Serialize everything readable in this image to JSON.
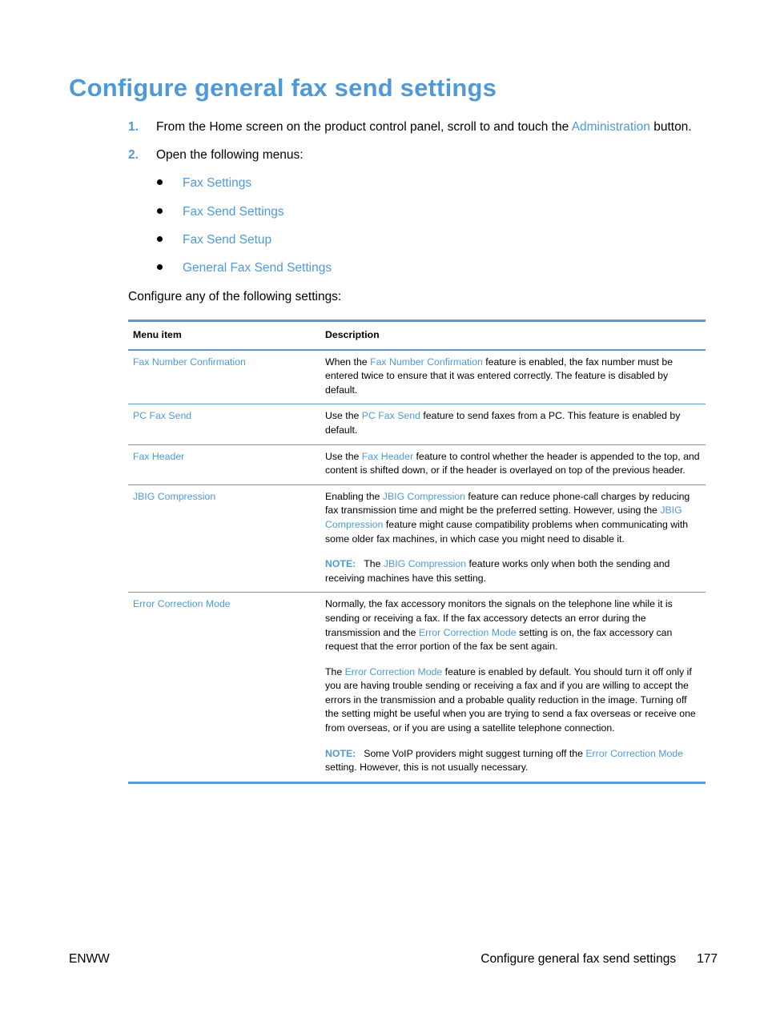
{
  "page": {
    "title": "Configure general fax send settings",
    "steps": [
      {
        "number": "1.",
        "before": "From the Home screen on the product control panel, scroll to and touch the ",
        "link": "Administration",
        "after": " button."
      },
      {
        "number": "2.",
        "text": "Open the following menus:"
      }
    ],
    "menus": [
      "Fax Settings",
      "Fax Send Settings",
      "Fax Send Setup",
      "General Fax Send Settings"
    ],
    "intro": "Configure any of the following settings:"
  },
  "table": {
    "headers": {
      "menu_item": "Menu item",
      "description": "Description"
    },
    "rows": [
      {
        "item": "Fax Number Confirmation",
        "p1": {
          "a": "When the ",
          "link": "Fax Number Confirmation",
          "b": " feature is enabled, the fax number must be entered twice to ensure that it was entered correctly. The feature is disabled by default."
        }
      },
      {
        "item": "PC Fax Send",
        "p1": {
          "a": "Use the ",
          "link": "PC Fax Send",
          "b": " feature to send faxes from a PC. This feature is enabled by default."
        }
      },
      {
        "item": "Fax Header",
        "p1": {
          "a": "Use the ",
          "link": "Fax Header",
          "b": " feature to control whether the header is appended to the top, and content is shifted down, or if the header is overlayed on top of the previous header."
        }
      },
      {
        "item": "JBIG Compression",
        "p1": {
          "a": "Enabling the ",
          "link": "JBIG Compression",
          "b": " feature can reduce phone-call charges by reducing fax transmission time and might be the preferred setting. However, using the ",
          "link2": "JBIG Compression",
          "c": " feature might cause compatibility problems when communicating with some older fax machines, in which case you might need to disable it."
        },
        "note": {
          "label": "NOTE:",
          "a": "The ",
          "link": "JBIG Compression",
          "b": " feature works only when both the sending and receiving machines have this setting."
        }
      },
      {
        "item": "Error Correction Mode",
        "p1": {
          "a": "Normally, the fax accessory monitors the signals on the telephone line while it is sending or receiving a fax. If the fax accessory detects an error during the transmission and the ",
          "link": "Error Correction Mode",
          "b": " setting is on, the fax accessory can request that the error portion of the fax be sent again."
        },
        "p2": {
          "a": "The ",
          "link": "Error Correction Mode",
          "b": " feature is enabled by default. You should turn it off only if you are having trouble sending or receiving a fax and if you are willing to accept the errors in the transmission and a probable quality reduction in the image. Turning off the setting might be useful when you are trying to send a fax overseas or receive one from overseas, or if you are using a satellite telephone connection."
        },
        "note": {
          "label": "NOTE:",
          "a": "Some VoIP providers might suggest turning off the ",
          "link": "Error Correction Mode",
          "b": " setting. However, this is not usually necessary."
        }
      }
    ]
  },
  "footer": {
    "left": "ENWW",
    "section": "Configure general fax send settings",
    "page_number": "177"
  },
  "colors": {
    "accent": "#4f9ad6",
    "rule": "#5b9bd0"
  }
}
